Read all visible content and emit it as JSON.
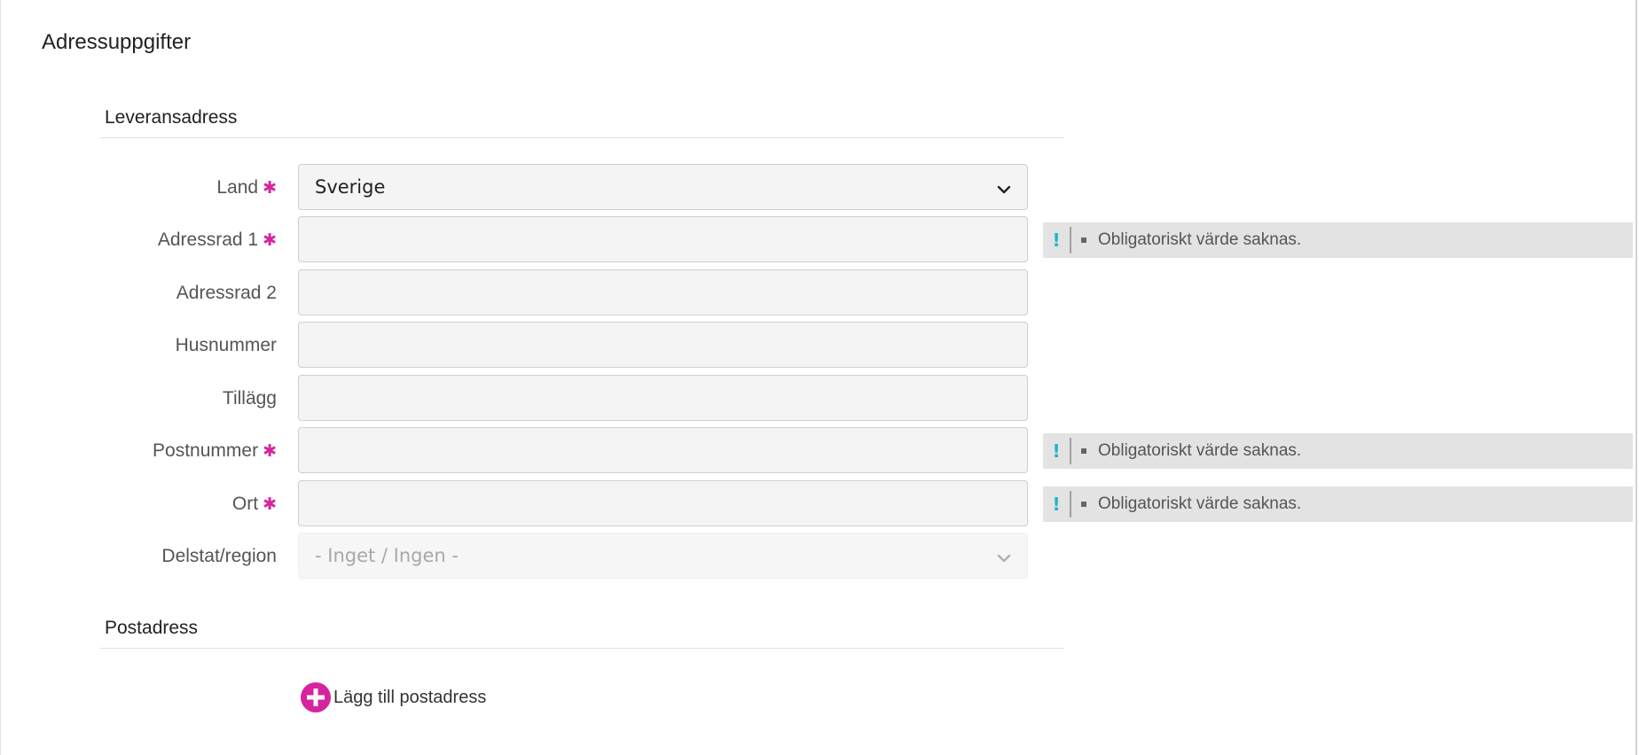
{
  "page": {
    "title": "Adressuppgifter"
  },
  "delivery": {
    "title": "Leveransadress",
    "fields": [
      {
        "label": "Land",
        "required": "✱",
        "type": "select",
        "value": "Sverige"
      },
      {
        "label": "Adressrad 1",
        "required": "✱",
        "type": "text",
        "value": "",
        "error": "Obligatoriskt värde saknas."
      },
      {
        "label": "Adressrad 2",
        "type": "text",
        "value": ""
      },
      {
        "label": "Husnummer",
        "type": "text",
        "value": ""
      },
      {
        "label": "Tillägg",
        "type": "text",
        "value": ""
      },
      {
        "label": "Postnummer",
        "required": "✱",
        "type": "text",
        "value": "",
        "error": "Obligatoriskt värde saknas."
      },
      {
        "label": "Ort",
        "required": "✱",
        "type": "text",
        "value": "",
        "error": "Obligatoriskt värde saknas."
      },
      {
        "label": "Delstat/region",
        "type": "select-disabled",
        "value": "- Inget / Ingen -"
      }
    ]
  },
  "postal": {
    "title": "Postadress",
    "add_label": "Lägg till postadress"
  },
  "error_marker": "!",
  "colors": {
    "accent": "#d6249f",
    "info": "#1fb5c7",
    "error_bg": "#e3e3e3"
  }
}
